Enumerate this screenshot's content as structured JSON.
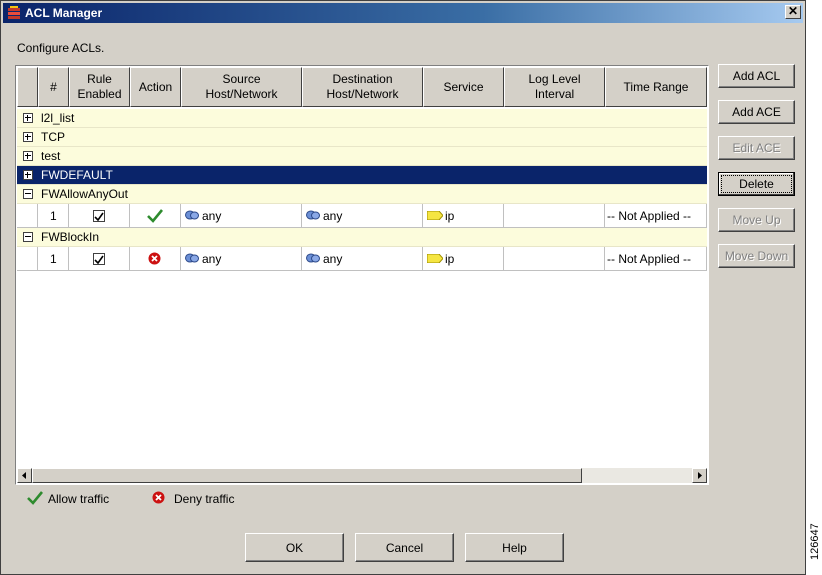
{
  "window": {
    "title": "ACL Manager",
    "instructions": "Configure ACLs."
  },
  "table": {
    "columns": [
      "",
      "#",
      "Rule\nEnabled",
      "Action",
      "Source\nHost/Network",
      "Destination\nHost/Network",
      "Service",
      "Log Level\nInterval",
      "Time Range"
    ],
    "groups": [
      {
        "name": "l2l_list",
        "expanded": false,
        "selected": false
      },
      {
        "name": "TCP",
        "expanded": false,
        "selected": false
      },
      {
        "name": "test",
        "expanded": false,
        "selected": false
      },
      {
        "name": "FWDEFAULT",
        "expanded": false,
        "selected": true
      },
      {
        "name": "FWAllowAnyOut",
        "expanded": true,
        "selected": false,
        "rule": {
          "num": "1",
          "enabled": true,
          "action": "allow",
          "source": "any",
          "destination": "any",
          "service": "ip",
          "log_level": "",
          "time_range": "-- Not Applied --"
        }
      },
      {
        "name": "FWBlockIn",
        "expanded": true,
        "selected": false,
        "rule": {
          "num": "1",
          "enabled": true,
          "action": "deny",
          "source": "any",
          "destination": "any",
          "service": "ip",
          "log_level": "",
          "time_range": "-- Not Applied --"
        }
      }
    ]
  },
  "side_buttons": [
    {
      "label": "Add ACL",
      "enabled": true,
      "focused": false
    },
    {
      "label": "Add ACE",
      "enabled": true,
      "focused": false
    },
    {
      "label": "Edit ACE",
      "enabled": false,
      "focused": false
    },
    {
      "label": "Delete",
      "enabled": true,
      "focused": true
    },
    {
      "label": "Move Up",
      "enabled": false,
      "focused": false
    },
    {
      "label": "Move Down",
      "enabled": false,
      "focused": false
    }
  ],
  "legend": {
    "allow": "Allow traffic",
    "deny": "Deny traffic"
  },
  "bottom_buttons": {
    "ok": "OK",
    "cancel": "Cancel",
    "help": "Help"
  },
  "figure_id": "126647",
  "colors": {
    "allow": "#2e8b2e",
    "deny": "#cc1111",
    "selected_row": "#0a246a",
    "group_row": "#fcfcdc"
  }
}
